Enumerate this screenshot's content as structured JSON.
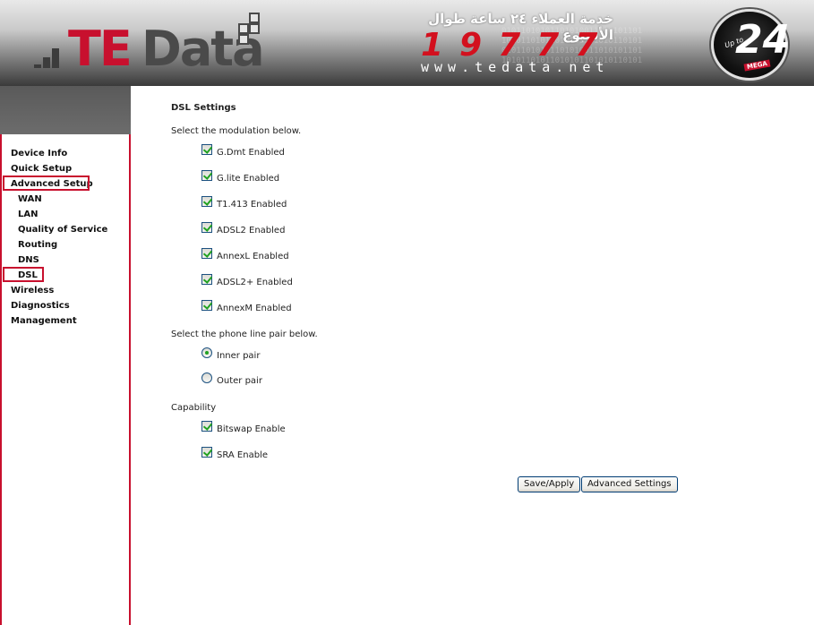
{
  "header": {
    "logo_te": "TE",
    "logo_data": "Data",
    "hotline_arabic": "خدمة العملاء ٢٤ ساعة طوال الأسبوع",
    "hotline_number": "19777",
    "website": "www.tedata.net",
    "badge_upto": "Up to",
    "badge_number": "24",
    "badge_mega": "MEGA",
    "colors": {
      "brand_red": "#c8102e",
      "header_dark": "#3a3a3a"
    }
  },
  "sidebar": {
    "items": [
      {
        "label": "Device Info",
        "level": 0,
        "highlighted": false
      },
      {
        "label": "Quick Setup",
        "level": 0,
        "highlighted": false
      },
      {
        "label": "Advanced Setup",
        "level": 0,
        "highlighted": true
      },
      {
        "label": "WAN",
        "level": 1,
        "highlighted": false
      },
      {
        "label": "LAN",
        "level": 1,
        "highlighted": false
      },
      {
        "label": "Quality of Service",
        "level": 1,
        "highlighted": false
      },
      {
        "label": "Routing",
        "level": 1,
        "highlighted": false
      },
      {
        "label": "DNS",
        "level": 1,
        "highlighted": false
      },
      {
        "label": "DSL",
        "level": 1,
        "highlighted": true
      },
      {
        "label": "Wireless",
        "level": 0,
        "highlighted": false
      },
      {
        "label": "Diagnostics",
        "level": 0,
        "highlighted": false
      },
      {
        "label": "Management",
        "level": 0,
        "highlighted": false
      }
    ]
  },
  "main": {
    "title": "DSL Settings",
    "modulation_prompt": "Select the modulation below.",
    "modulations": [
      {
        "label": "G.Dmt Enabled",
        "checked": true
      },
      {
        "label": "G.lite Enabled",
        "checked": true
      },
      {
        "label": "T1.413 Enabled",
        "checked": true
      },
      {
        "label": "ADSL2 Enabled",
        "checked": true
      },
      {
        "label": "AnnexL Enabled",
        "checked": true
      },
      {
        "label": "ADSL2+ Enabled",
        "checked": true
      },
      {
        "label": "AnnexM Enabled",
        "checked": true
      }
    ],
    "pair_prompt": "Select the phone line pair below.",
    "pairs": [
      {
        "label": "Inner pair",
        "selected": true
      },
      {
        "label": "Outer pair",
        "selected": false
      }
    ],
    "capability_label": "Capability",
    "capabilities": [
      {
        "label": "Bitswap Enable",
        "checked": true
      },
      {
        "label": "SRA Enable",
        "checked": true
      }
    ],
    "buttons": {
      "save_apply": "Save/Apply",
      "advanced_settings": "Advanced Settings"
    }
  }
}
